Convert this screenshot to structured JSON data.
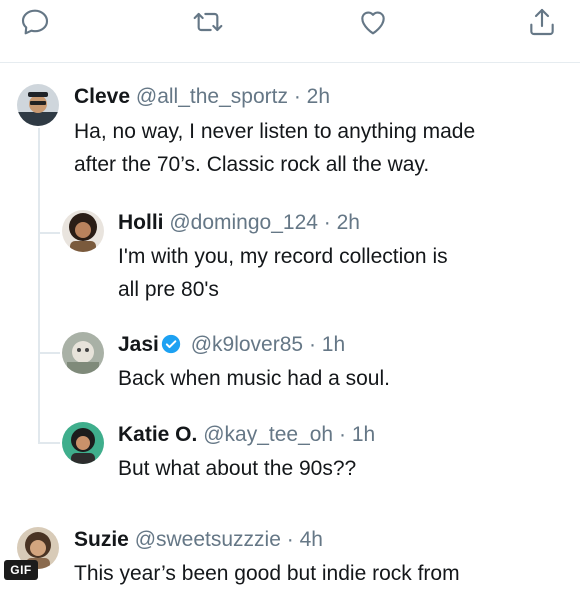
{
  "actions": {
    "reply_icon": "speech-bubble-icon",
    "retweet_icon": "retweet-icon",
    "like_icon": "heart-icon",
    "share_icon": "share-icon"
  },
  "tweets": [
    {
      "name": "Cleve",
      "handle": "@all_the_sportz",
      "sep": "·",
      "time": "2h",
      "text_line1": "Ha, no way, I never listen to anything made",
      "text_line2": "after the 70’s. Classic rock all the way."
    },
    {
      "name": "Holli",
      "handle": "@domingo_124",
      "sep": "·",
      "time": "2h",
      "text_line1": "I'm with you, my record collection is",
      "text_line2": "all pre 80's"
    },
    {
      "name": "Jasi",
      "handle": "@k9lover85",
      "sep": "·",
      "time": "1h",
      "verified": true,
      "text_line1": "Back when music had a soul."
    },
    {
      "name": "Katie O.",
      "handle": "@kay_tee_oh",
      "sep": "·",
      "time": "1h",
      "text_line1": "But what about the 90s??"
    },
    {
      "name": "Suzie",
      "handle": "@sweetsuzzzie",
      "sep": "·",
      "time": "4h",
      "text_line1": "This year’s been good but indie rock from"
    }
  ],
  "gif_badge": "GIF",
  "colors": {
    "text": "#14171a",
    "secondary": "#657786",
    "verified": "#1da1f2",
    "icon": "#657786"
  }
}
